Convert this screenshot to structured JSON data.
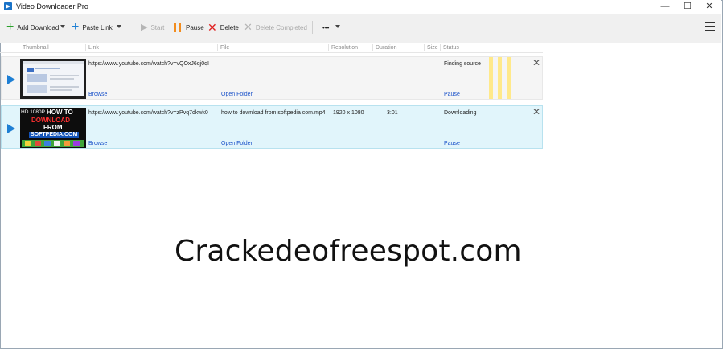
{
  "window": {
    "title": "Video Downloader Pro",
    "minimize": "—",
    "maximize": "☐",
    "close": "✕"
  },
  "toolbar": {
    "add_download": "Add Download",
    "paste_link": "Paste Link",
    "start": "Start",
    "pause": "Pause",
    "delete": "Delete",
    "delete_completed": "Delete Completed",
    "more": "•••"
  },
  "columns": [
    "Thumbnail",
    "Link",
    "File",
    "Resolution",
    "Duration",
    "Size",
    "Status"
  ],
  "rows": [
    {
      "link": "https://www.youtube.com/watch?v=vQOxJ6qj0qI",
      "file": "",
      "resolution": "",
      "duration": "",
      "status": "Finding source",
      "browse": "Browse",
      "open_folder": "Open Folder",
      "action": "Pause"
    },
    {
      "link": "https://www.youtube.com/watch?v=zPvq7dkwk0",
      "file": "how to download from softpedia com.mp4",
      "resolution": "1920 x 1080",
      "duration": "3:01",
      "status": "Downloading",
      "browse": "Browse",
      "open_folder": "Open Folder",
      "action": "Pause",
      "thumb_text": [
        "HD 1080P",
        "HOW TO",
        "DOWNLOAD",
        "FROM",
        "SOFTPEDIA.COM"
      ]
    }
  ],
  "watermark": "Crackedeofreespot.com",
  "colors": {
    "accent_blue": "#1e7fd4",
    "link_blue": "#1a52c9",
    "selected_row": "#e1f5fb",
    "pause_orange": "#f28c1e",
    "delete_red": "#e02020",
    "add_green": "#2aa02a"
  }
}
